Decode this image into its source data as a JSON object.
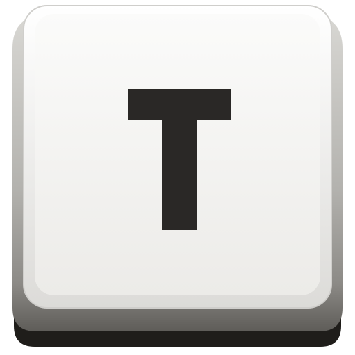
{
  "key": {
    "label": "T",
    "icon": "keyboard-key-t-icon",
    "colors": {
      "cap_face": "#f0efed",
      "cap_rim": "#e6e5e2",
      "side_light": "#b9b8b4",
      "side_dark": "#6a6864",
      "base_shadow": "#1f1d1a",
      "glyph": "#2a2826"
    }
  }
}
